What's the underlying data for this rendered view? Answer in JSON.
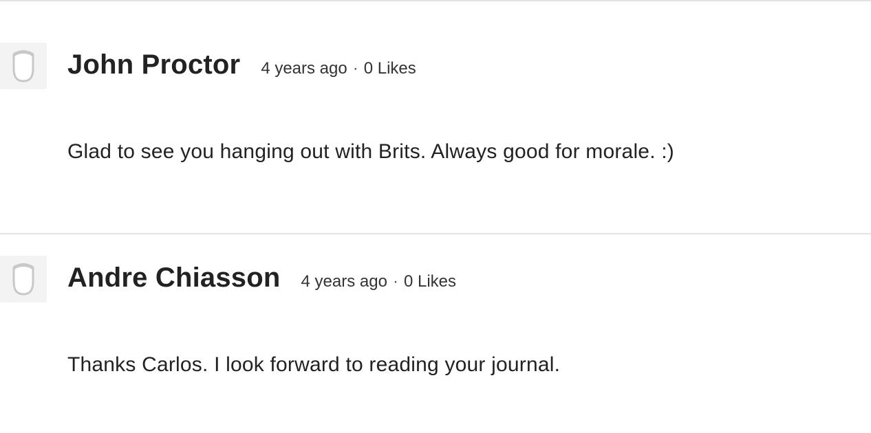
{
  "comments": [
    {
      "author": "John Proctor",
      "time": "4 years ago",
      "separator": "·",
      "likes": "0 Likes",
      "text": "Glad to see you hanging out with Brits. Always good for morale. :)",
      "avatar_icon": "default-avatar-icon"
    },
    {
      "author": "Andre Chiasson",
      "time": "4 years ago",
      "separator": "·",
      "likes": "0 Likes",
      "text": "Thanks Carlos. I look forward to reading your journal.",
      "avatar_icon": "default-avatar-icon"
    }
  ],
  "colors": {
    "divider": "#e2e2e2",
    "avatar_bg": "#f3f3f3",
    "avatar_stroke": "#c8c8c8",
    "text": "#222222"
  }
}
